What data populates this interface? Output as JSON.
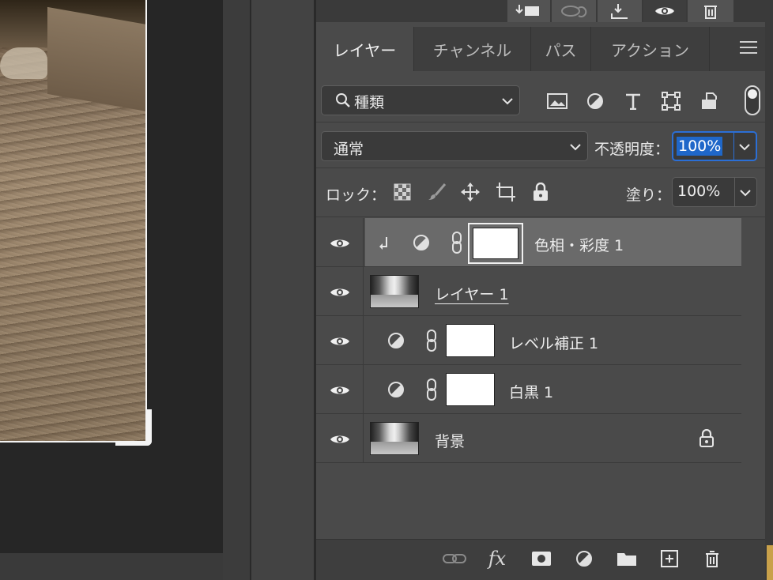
{
  "toolbar_top": {
    "icons": [
      "import-icon",
      "hide-link-icon",
      "download-icon",
      "eye-icon",
      "trash-icon"
    ]
  },
  "tabs": [
    {
      "label": "レイヤー",
      "active": true
    },
    {
      "label": "チャンネル",
      "active": false
    },
    {
      "label": "パス",
      "active": false
    },
    {
      "label": "アクション",
      "active": false
    }
  ],
  "filter": {
    "label": "種類",
    "icons": [
      "image-filter-icon",
      "adjustment-filter-icon",
      "type-filter-icon",
      "shape-filter-icon",
      "smartobject-filter-icon"
    ]
  },
  "blend": {
    "mode": "通常",
    "opacity_label": "不透明度：",
    "opacity_value": "100%"
  },
  "lock": {
    "label": "ロック：",
    "fill_label": "塗り：",
    "fill_value": "100%"
  },
  "layers": [
    {
      "name": "色相・彩度 1",
      "type": "adjustment",
      "clipped": true,
      "selected": true
    },
    {
      "name": "レイヤー 1",
      "type": "pixel",
      "underlined": true
    },
    {
      "name": "レベル補正 1",
      "type": "adjustment"
    },
    {
      "name": "白黒 1",
      "type": "adjustment"
    },
    {
      "name": "背景",
      "type": "pixel",
      "locked": true
    }
  ],
  "bottom_bar": {
    "fx_label": "fx",
    "icons": [
      "link-layers-icon",
      "fx-icon",
      "mask-icon",
      "adjustment-icon",
      "folder-icon",
      "new-layer-icon",
      "delete-icon"
    ]
  },
  "colors": {
    "panel": "#4a4a4a",
    "selected_row": "#6a6a6a",
    "accent": "#1f67c9"
  }
}
